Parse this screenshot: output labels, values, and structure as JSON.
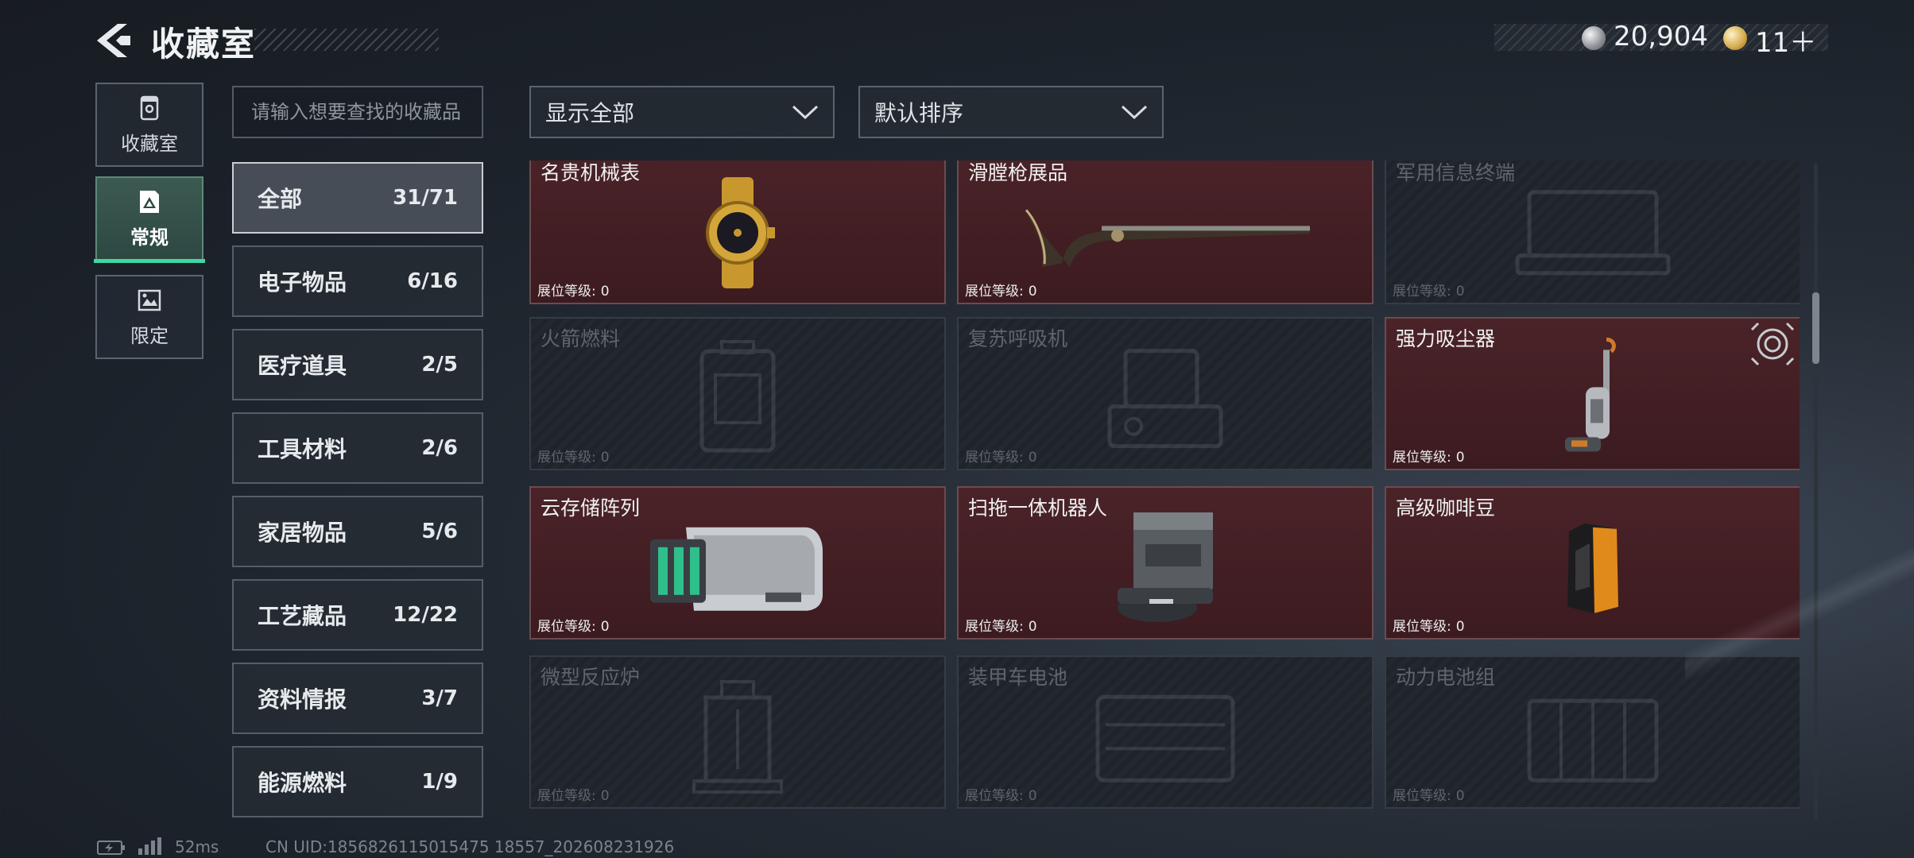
{
  "header": {
    "title": "收藏室",
    "currency": [
      {
        "icon": "silver-coin-icon",
        "value": "20,904"
      },
      {
        "icon": "gold-coin-icon",
        "value": "11＋"
      }
    ]
  },
  "nav": [
    {
      "label": "收藏室",
      "icon": "collection-room-icon",
      "active": false
    },
    {
      "label": "常规",
      "icon": "regular-card-icon",
      "active": true
    },
    {
      "label": "限定",
      "icon": "limited-card-icon",
      "active": false
    }
  ],
  "search": {
    "placeholder": "请输入想要查找的收藏品"
  },
  "filters": {
    "show": "显示全部",
    "sort": "默认排序"
  },
  "categories": [
    {
      "name": "全部",
      "count": "31/71",
      "active": true
    },
    {
      "name": "电子物品",
      "count": "6/16"
    },
    {
      "name": "医疗道具",
      "count": "2/5"
    },
    {
      "name": "工具材料",
      "count": "2/6"
    },
    {
      "name": "家居物品",
      "count": "5/6"
    },
    {
      "name": "工艺藏品",
      "count": "12/22"
    },
    {
      "name": "资料情报",
      "count": "3/7"
    },
    {
      "name": "能源燃料",
      "count": "1/9"
    }
  ],
  "level_label": "展位等级:",
  "items": [
    {
      "name": "名贵机械表",
      "level": "0",
      "owned": true,
      "icon": "watch-icon"
    },
    {
      "name": "滑膛枪展品",
      "level": "0",
      "owned": true,
      "icon": "musket-icon"
    },
    {
      "name": "军用信息终端",
      "level": "0",
      "owned": false,
      "icon": "terminal-icon"
    },
    {
      "name": "火箭燃料",
      "level": "0",
      "owned": false,
      "icon": "fuel-canister-icon"
    },
    {
      "name": "复苏呼吸机",
      "level": "0",
      "owned": false,
      "icon": "ventilator-icon"
    },
    {
      "name": "强力吸尘器",
      "level": "0",
      "owned": true,
      "icon": "vacuum-icon"
    },
    {
      "name": "云存储阵列",
      "level": "0",
      "owned": true,
      "icon": "storage-array-icon"
    },
    {
      "name": "扫拖一体机器人",
      "level": "0",
      "owned": true,
      "icon": "robot-vacuum-icon"
    },
    {
      "name": "高级咖啡豆",
      "level": "0",
      "owned": true,
      "icon": "coffee-bag-icon"
    },
    {
      "name": "微型反应炉",
      "level": "0",
      "owned": false,
      "icon": "reactor-icon"
    },
    {
      "name": "装甲车电池",
      "level": "0",
      "owned": false,
      "icon": "battery-icon"
    },
    {
      "name": "动力电池组",
      "level": "0",
      "owned": false,
      "icon": "battery-pack-icon"
    }
  ],
  "footer": {
    "ping": "52ms",
    "uid": "CN UID:1856826115015475 18557_202608231926"
  }
}
